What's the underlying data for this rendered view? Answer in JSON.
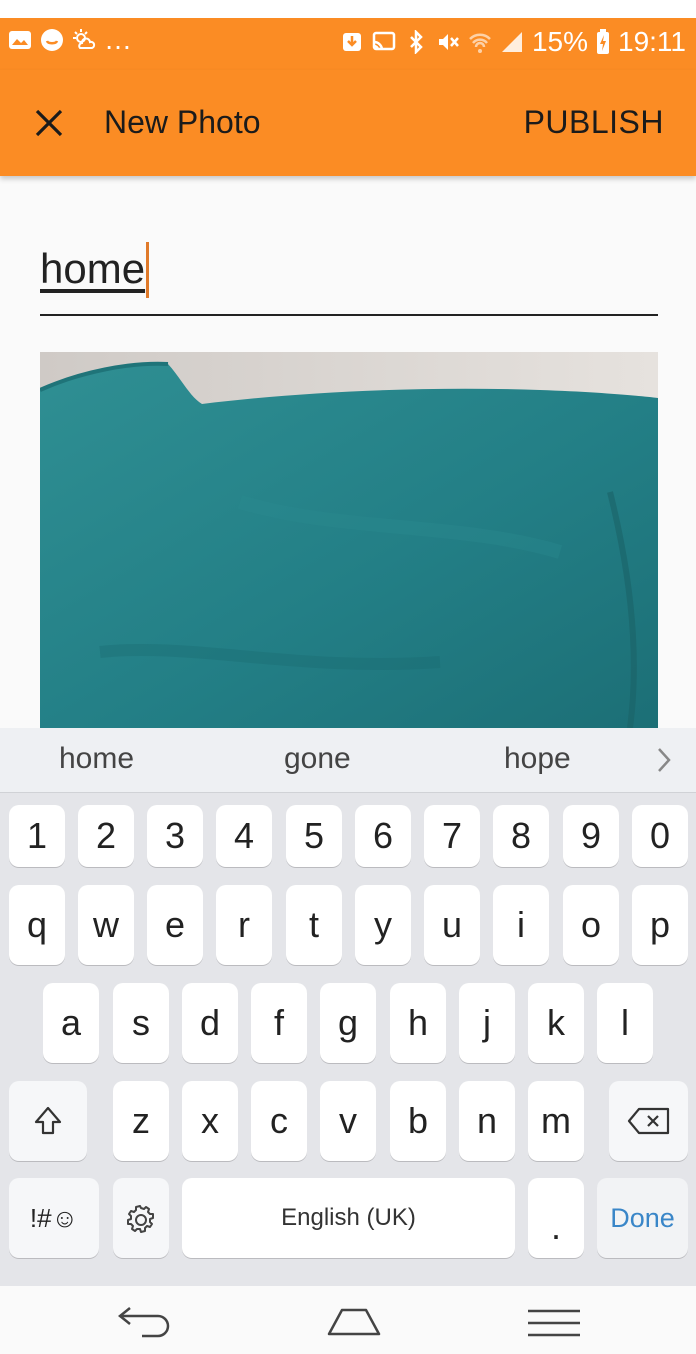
{
  "status_bar": {
    "battery": "15%",
    "time": "19:11",
    "icons": [
      "gallery-icon",
      "chat-icon",
      "weather-icon",
      "more-dots",
      "download-icon",
      "cast-icon",
      "bluetooth-icon",
      "mute-icon",
      "wifi-icon",
      "signal-icon",
      "battery-icon"
    ]
  },
  "app_bar": {
    "close_icon": "close-icon",
    "title": "New Photo",
    "publish_label": "PUBLISH"
  },
  "caption": {
    "value": "home"
  },
  "keyboard": {
    "suggestions": [
      "home",
      "gone",
      "hope"
    ],
    "row_numbers": [
      "1",
      "2",
      "3",
      "4",
      "5",
      "6",
      "7",
      "8",
      "9",
      "0"
    ],
    "row1": [
      "q",
      "w",
      "e",
      "r",
      "t",
      "y",
      "u",
      "i",
      "o",
      "p"
    ],
    "row2": [
      "a",
      "s",
      "d",
      "f",
      "g",
      "h",
      "j",
      "k",
      "l"
    ],
    "row3": [
      "z",
      "x",
      "c",
      "v",
      "b",
      "n",
      "m"
    ],
    "symbols_label": "!#☺",
    "space_label": "English (UK)",
    "period_label": ".",
    "done_label": "Done"
  },
  "colors": {
    "accent": "#fb8c24",
    "done_blue": "#3a86c8"
  }
}
